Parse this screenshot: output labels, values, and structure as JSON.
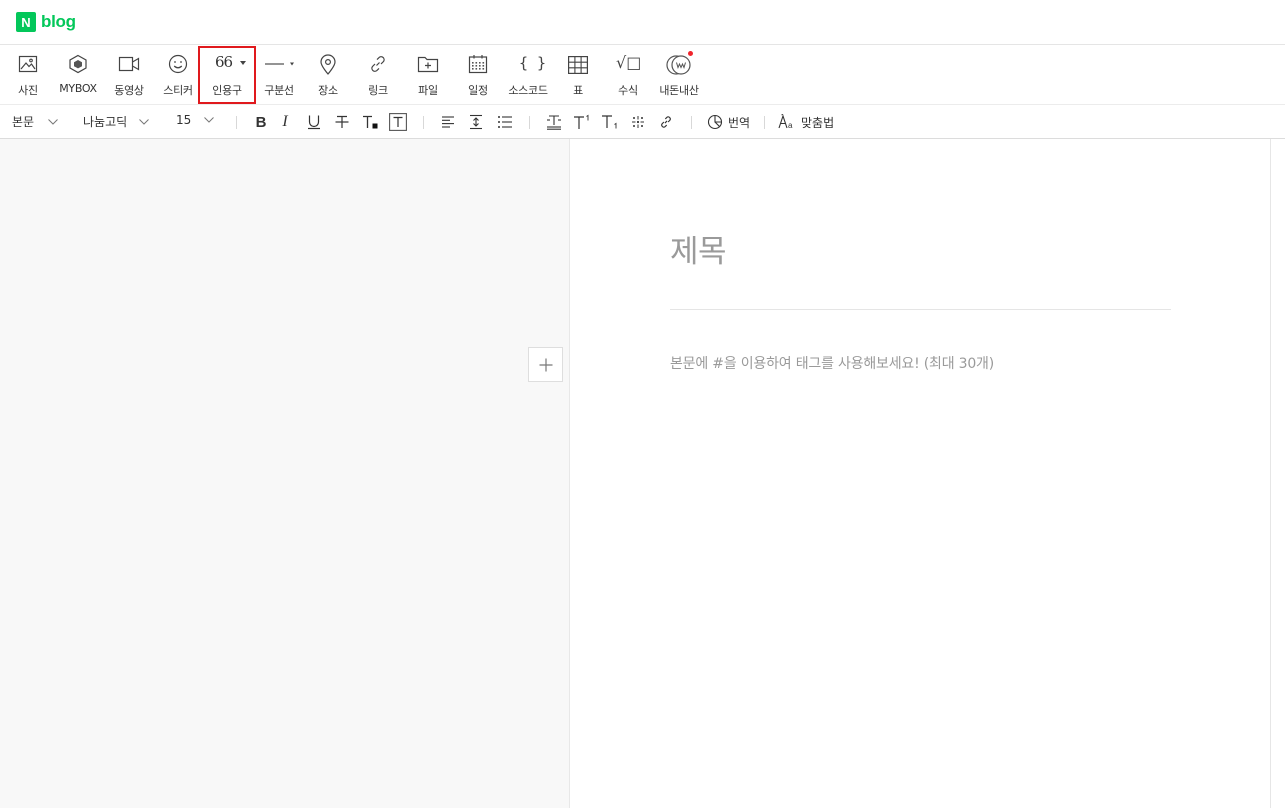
{
  "app": {
    "logo_badge": "N",
    "logo_text": "blog",
    "brand_color": "#03c75a"
  },
  "insert_toolbar": {
    "items": [
      {
        "id": "photo",
        "label": "사진",
        "icon": "image-icon"
      },
      {
        "id": "mybox",
        "label": "MYBOX",
        "icon": "mybox-cube-icon"
      },
      {
        "id": "video",
        "label": "동영상",
        "icon": "video-camera-icon"
      },
      {
        "id": "sticker",
        "label": "스티커",
        "icon": "smiley-icon"
      },
      {
        "id": "quote",
        "label": "인용구",
        "icon": "quote-icon",
        "glyph": "66",
        "highlighted": true
      },
      {
        "id": "divider",
        "label": "구분선",
        "icon": "horizontal-line-icon"
      },
      {
        "id": "place",
        "label": "장소",
        "icon": "map-pin-icon"
      },
      {
        "id": "link",
        "label": "링크",
        "icon": "link-icon"
      },
      {
        "id": "file",
        "label": "파일",
        "icon": "folder-plus-icon"
      },
      {
        "id": "schedule",
        "label": "일정",
        "icon": "calendar-icon"
      },
      {
        "id": "sourcecode",
        "label": "소스코드",
        "icon": "braces-icon",
        "glyph": "{ }"
      },
      {
        "id": "table",
        "label": "표",
        "icon": "table-grid-icon"
      },
      {
        "id": "formula",
        "label": "수식",
        "icon": "square-root-icon",
        "glyph": "√□"
      },
      {
        "id": "naedon",
        "label": "내돈내산",
        "icon": "coin-badge-icon",
        "has_notification_dot": true
      }
    ],
    "highlight_color": "#e0191d"
  },
  "format_toolbar": {
    "paragraph_style": "본문",
    "font_family": "나눔고딕",
    "font_size": "15",
    "bold_glyph": "B",
    "italic_glyph": "I",
    "translate_label": "번역",
    "spellcheck_label": "맞춤법"
  },
  "editor": {
    "title_placeholder": "제목",
    "body_placeholder": "본문에 #을 이용하여 태그를 사용해보세요! (최대 30개)"
  }
}
